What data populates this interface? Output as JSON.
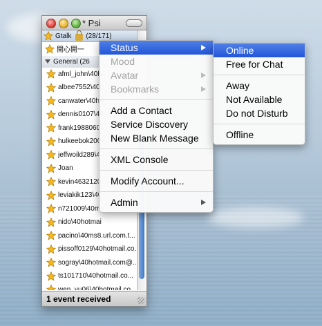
{
  "window": {
    "title": "* Psi"
  },
  "account": {
    "name": "Gtalk",
    "count": "(28/171)"
  },
  "self_contact": "開心開一",
  "group": {
    "name": "General",
    "count": "(26"
  },
  "contacts": [
    "afml_john\\40h",
    "albee7552\\40h",
    "canwater\\40ho",
    "dennis0107\\40",
    "frank1988060",
    "hulkeebok200",
    "jeffwoild289\\4",
    "Joan",
    "kevin4632120",
    "leviakik123\\40",
    "n721009\\40ms",
    "nido\\40hotmai",
    "pacino\\40ms8.url.com.t...",
    "pissoff0129\\40hotmail.co...",
    "sogray\\40hotmail.com@...",
    "ts101710\\40hotmail.co...",
    "wen_yu06\\40hotmail.co...",
    "yan751018\\40hotmail.co..."
  ],
  "status_bar": "1 event received",
  "context_menu": {
    "items": [
      {
        "label": "Status",
        "state": "selected",
        "submenu": true
      },
      {
        "label": "Mood",
        "state": "disabled",
        "submenu": false
      },
      {
        "label": "Avatar",
        "state": "disabled",
        "submenu": true
      },
      {
        "label": "Bookmarks",
        "state": "disabled",
        "submenu": true
      },
      {
        "label": "Add a Contact",
        "state": "normal",
        "submenu": false
      },
      {
        "label": "Service Discovery",
        "state": "normal",
        "submenu": false
      },
      {
        "label": "New Blank Message",
        "state": "normal",
        "submenu": false
      },
      {
        "label": "XML Console",
        "state": "normal",
        "submenu": false
      },
      {
        "label": "Modify Account...",
        "state": "normal",
        "submenu": false
      },
      {
        "label": "Admin",
        "state": "normal",
        "submenu": true
      }
    ]
  },
  "status_submenu": {
    "items": [
      {
        "label": "Online",
        "state": "selected"
      },
      {
        "label": "Free for Chat",
        "state": "normal"
      },
      {
        "label": "Away",
        "state": "normal"
      },
      {
        "label": "Not Available",
        "state": "normal"
      },
      {
        "label": "Do not Disturb",
        "state": "normal"
      },
      {
        "label": "Offline",
        "state": "normal"
      }
    ]
  },
  "icons": {
    "contact": "star-status-icon",
    "lock": "lock-icon",
    "group_toggle": "triangle-down-icon"
  },
  "colors": {
    "selection": "#2f63dc",
    "star": "#f5b820"
  }
}
